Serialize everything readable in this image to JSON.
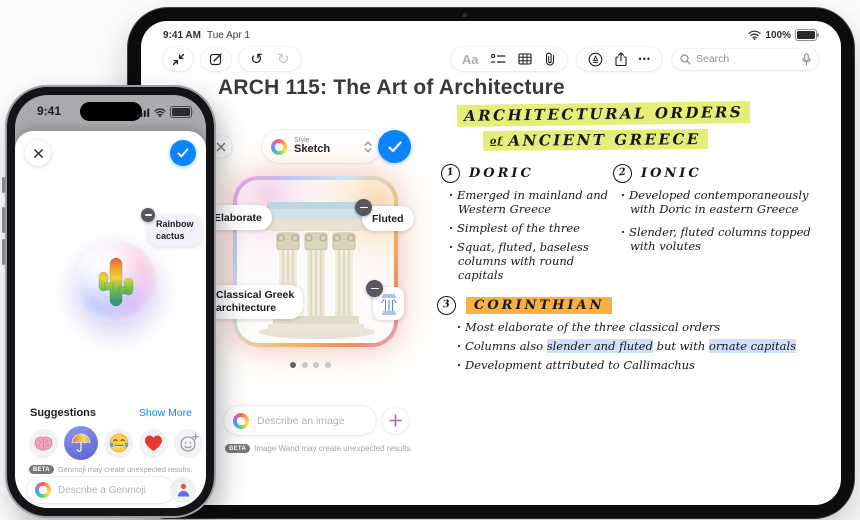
{
  "ipad": {
    "status": {
      "time": "9:41 AM",
      "date": "Tue Apr 1",
      "battery_pct": "100%"
    },
    "toolbar": {
      "undo_icon": "↺",
      "redo_icon": "↻",
      "aa_label": "Aa",
      "ellipsis": "•••",
      "search_placeholder": "Search"
    },
    "note_title": "ARCH 115: The Art of Architecture",
    "image_wand": {
      "style_label": "Style",
      "style_value": "Sketch",
      "tag_elaborate": "Elaborate",
      "tag_fluted": "Fluted",
      "tag_classical_line1": "Classical Greek",
      "tag_classical_line2": "architecture",
      "input_placeholder": "Describe an image",
      "beta": "BETA",
      "disclaimer": "Image Wand may create unexpected results."
    },
    "notes": {
      "heading1": "ARCHITECTURAL ORDERS",
      "heading2_of": "of",
      "heading2": "ANCIENT GREECE",
      "doric": {
        "num": "1",
        "title": "DORIC",
        "b1": "Emerged in mainland and Western Greece",
        "b2": "Simplest of the three",
        "b3": "Squat, fluted, baseless columns with round capitals"
      },
      "ionic": {
        "num": "2",
        "title": "IONIC",
        "b1": "Developed contemporaneously with Doric in eastern Greece",
        "b2": "Slender, fluted columns topped with volutes"
      },
      "corinthian": {
        "num": "3",
        "title": "CORINTHIAN",
        "b1": "Most elaborate of the three classical orders",
        "b2_parts": [
          "Columns also ",
          "slender and fluted",
          " but with ",
          "ornate capitals"
        ],
        "b3": "Development attributed to Callimachus"
      }
    }
  },
  "iphone": {
    "status_time": "9:41",
    "genmoji": {
      "tag_line1": "Rainbow",
      "tag_line2": "cactus",
      "suggestions_label": "Suggestions",
      "show_more": "Show More",
      "beta": "BETA",
      "disclaimer": "Genmoji may create unexpected results.",
      "input_placeholder": "Describe a Genmoji",
      "suggestion_icons": [
        "brain",
        "rainbow-umbrella",
        "laughing-crying",
        "red-heart",
        "new-genmoji"
      ]
    }
  },
  "colors": {
    "accent_blue": "#0a84ff",
    "highlight_yellow": "#e5ee79",
    "highlight_orange": "#f6b143",
    "highlight_blue": "#cfe0f8"
  }
}
